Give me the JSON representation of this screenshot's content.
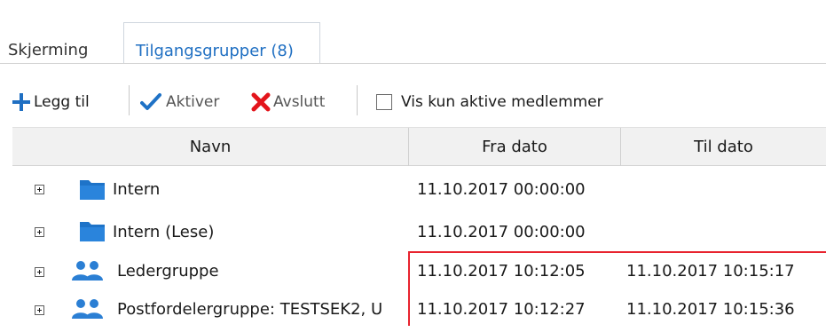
{
  "tabs": [
    {
      "label": "Skjerming",
      "active": false
    },
    {
      "label": "Tilgangsgrupper (8)",
      "active": true
    }
  ],
  "toolbar": {
    "add_label": "Legg til",
    "activate_label": "Aktiver",
    "end_label": "Avslutt",
    "active_only_label": "Vis kun aktive medlemmer",
    "active_only_checked": false
  },
  "grid": {
    "columns": [
      "Navn",
      "Fra dato",
      "Til dato"
    ],
    "rows": [
      {
        "icon": "folder-icon",
        "name": "Intern",
        "from": "11.10.2017 00:00:00",
        "to": ""
      },
      {
        "icon": "folder-icon",
        "name": "Intern (Lese)",
        "from": "11.10.2017 00:00:00",
        "to": ""
      },
      {
        "icon": "user-group-icon",
        "name": "Ledergruppe",
        "from": "11.10.2017 10:12:05",
        "to": "11.10.2017 10:15:17"
      },
      {
        "icon": "user-group-icon",
        "name": "Postfordelergruppe: TESTSEK2, U",
        "from": "11.10.2017 10:12:27",
        "to": "11.10.2017 10:15:36"
      }
    ]
  },
  "colors": {
    "accent": "#1f6fc2",
    "folder": "#1e73c8",
    "group": "#2b7fd4",
    "check": "#1f72c6",
    "cross": "#e3141b",
    "highlight": "#e8232e"
  }
}
